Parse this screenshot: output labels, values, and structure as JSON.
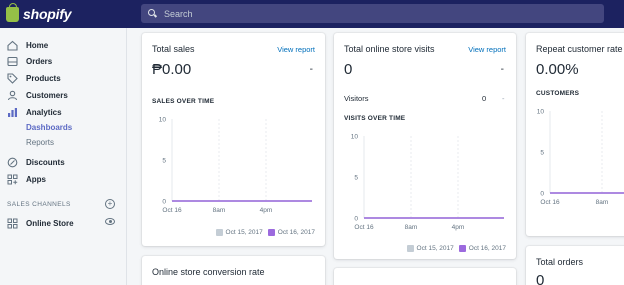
{
  "brand": {
    "name": "shopify"
  },
  "search": {
    "placeholder": "Search"
  },
  "sidebar": {
    "items": [
      {
        "label": "Home",
        "icon": "home-icon"
      },
      {
        "label": "Orders",
        "icon": "orders-icon"
      },
      {
        "label": "Products",
        "icon": "tag-icon"
      },
      {
        "label": "Customers",
        "icon": "customers-icon"
      },
      {
        "label": "Analytics",
        "icon": "analytics-icon"
      }
    ],
    "analytics_sub": [
      {
        "label": "Dashboards",
        "active": true
      },
      {
        "label": "Reports",
        "active": false
      }
    ],
    "items_after": [
      {
        "label": "Discounts",
        "icon": "discount-icon"
      },
      {
        "label": "Apps",
        "icon": "apps-icon"
      }
    ],
    "sales_channels_label": "SALES CHANNELS",
    "online_store_label": "Online Store"
  },
  "cards": {
    "total_sales": {
      "title": "Total sales",
      "link": "View report",
      "value": "₱0.00",
      "dash": "-",
      "section": "SALES OVER TIME"
    },
    "store_visits": {
      "title": "Total online store visits",
      "link": "View report",
      "value": "0",
      "dash": "-",
      "visitors_label": "Visitors",
      "visitors_value": "0",
      "visitors_dash": "-",
      "section": "VISITS OVER TIME"
    },
    "repeat_rate": {
      "title": "Repeat customer rate",
      "value": "0.00%",
      "section": "CUSTOMERS"
    },
    "conversion": {
      "title": "Online store conversion rate"
    },
    "total_orders": {
      "title": "Total orders",
      "value": "0"
    }
  },
  "legend": [
    {
      "label": "Oct 15, 2017",
      "color": "#c4cdd5"
    },
    {
      "label": "Oct 16, 2017",
      "color": "#9c6ade"
    }
  ],
  "chart_data": [
    {
      "type": "line",
      "x": [
        "Oct 16",
        "8am",
        "4pm"
      ],
      "ylim": [
        0,
        10
      ],
      "yticks": [
        "10",
        "5",
        "0"
      ],
      "series": [
        {
          "name": "Oct 15, 2017",
          "values": [
            0,
            0,
            0
          ]
        },
        {
          "name": "Oct 16, 2017",
          "values": [
            0,
            0,
            0
          ]
        }
      ]
    },
    {
      "type": "line",
      "x": [
        "Oct 16",
        "8am",
        "4pm"
      ],
      "ylim": [
        0,
        10
      ],
      "yticks": [
        "10",
        "5",
        "0"
      ],
      "series": [
        {
          "name": "Oct 15, 2017",
          "values": [
            0,
            0,
            0
          ]
        },
        {
          "name": "Oct 16, 2017",
          "values": [
            0,
            0,
            0
          ]
        }
      ]
    },
    {
      "type": "line",
      "x": [
        "Oct 16",
        "8am"
      ],
      "ylim": [
        0,
        10
      ],
      "yticks": [
        "10",
        "5",
        "0"
      ],
      "series": [
        {
          "name": "Oct 15, 2017",
          "values": [
            0,
            0
          ]
        },
        {
          "name": "Oct 16, 2017",
          "values": [
            0,
            0
          ]
        }
      ]
    }
  ]
}
